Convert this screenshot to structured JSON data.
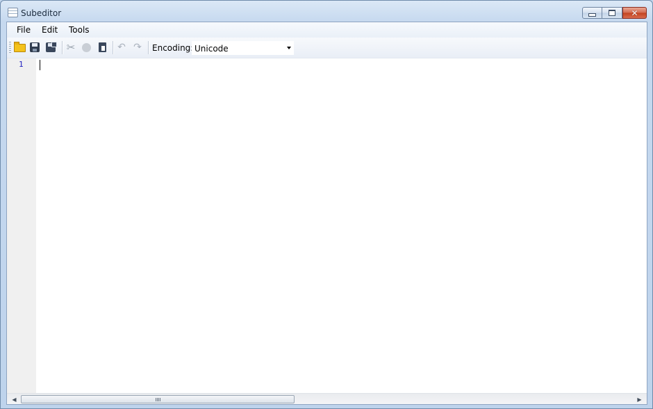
{
  "window": {
    "title": "Subeditor",
    "controls": {
      "minimize": "minimize",
      "maximize": "maximize",
      "close": "✕"
    }
  },
  "menubar": {
    "items": [
      "File",
      "Edit",
      "Tools"
    ]
  },
  "toolbar": {
    "buttons": [
      "open-icon",
      "save-icon",
      "save-as-icon",
      "cut-icon",
      "copy-icon",
      "paste-icon",
      "undo-icon",
      "redo-icon"
    ],
    "encoding_label": "Encoding:",
    "encoding_value": "Unicode"
  },
  "editor": {
    "line_numbers": [
      "1"
    ],
    "content": ""
  },
  "colors": {
    "line_number": "#2020c0",
    "gutter": "#f0f0f0",
    "title_bar": "#c6d9ef",
    "close_button": "#c2421f"
  }
}
